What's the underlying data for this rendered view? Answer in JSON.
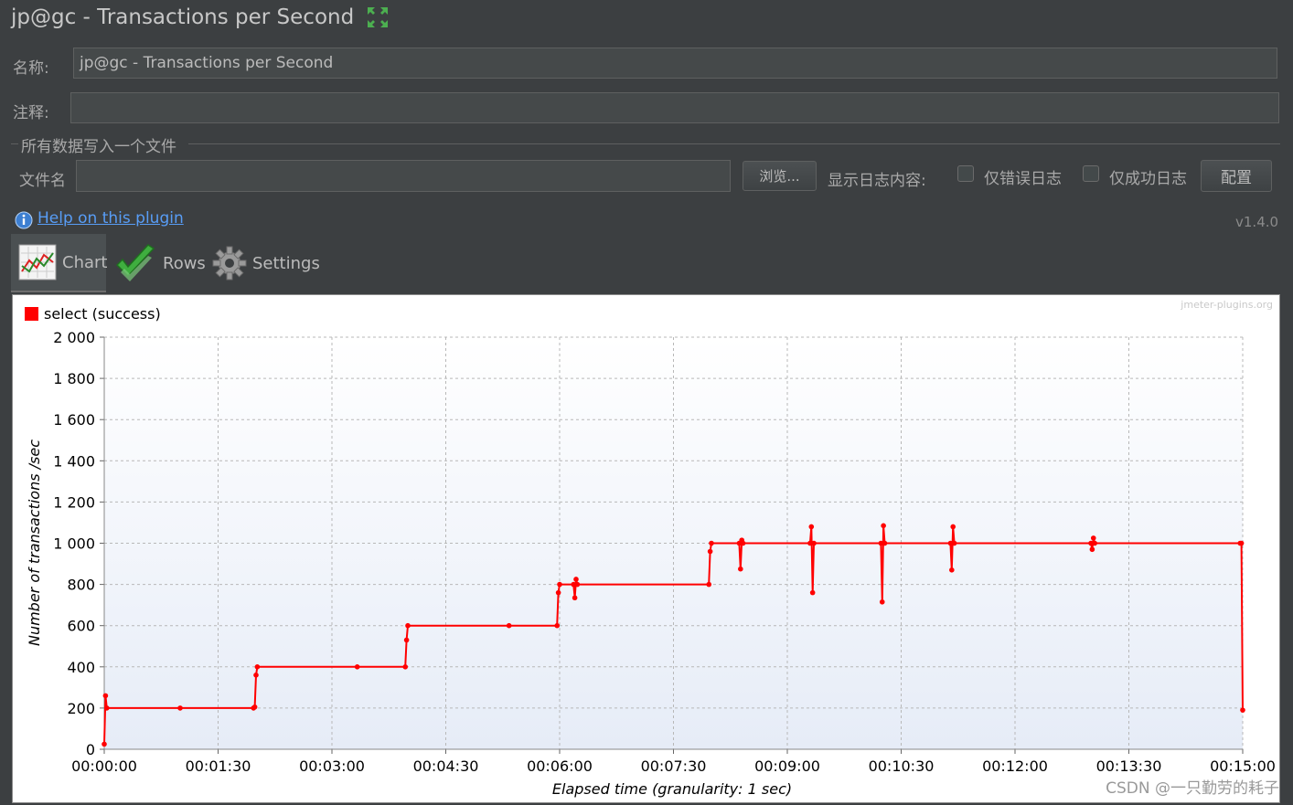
{
  "window": {
    "title": "jp@gc - Transactions per Second",
    "expand_icon": "expand-arrows-icon"
  },
  "form": {
    "name_label": "名称:",
    "name_value": "jp@gc - Transactions per Second",
    "comment_label": "注释:",
    "comment_value": "",
    "group_title": "所有数据写入一个文件",
    "filename_label": "文件名",
    "filename_value": "",
    "browse_button": "浏览...",
    "log_content_label": "显示日志内容:",
    "errors_only_label": "仅错误日志",
    "success_only_label": "仅成功日志",
    "configure_button": "配置"
  },
  "help": {
    "icon": "info-icon",
    "link_text": "Help on this plugin",
    "version": "v1.4.0"
  },
  "tabs": [
    {
      "label": "Chart",
      "icon": "chart-icon",
      "active": true
    },
    {
      "label": "Rows",
      "icon": "checkmark-icon",
      "active": false
    },
    {
      "label": "Settings",
      "icon": "gear-icon",
      "active": false
    }
  ],
  "watermark": "jmeter-plugins.org",
  "credit": "CSDN @一只勤劳的耗子",
  "chart_data": {
    "type": "line",
    "title": "",
    "xlabel": "Elapsed time (granularity: 1 sec)",
    "ylabel": "Number of transactions /sec",
    "ylim": [
      0,
      2000
    ],
    "xlim_seconds": [
      0,
      900
    ],
    "x_ticks": [
      "00:00:00",
      "00:01:30",
      "00:03:00",
      "00:04:30",
      "00:06:00",
      "00:07:30",
      "00:09:00",
      "00:10:30",
      "00:12:00",
      "00:13:30",
      "00:15:00"
    ],
    "y_ticks": [
      "0",
      "200",
      "400",
      "600",
      "800",
      "1 000",
      "1 200",
      "1 400",
      "1 600",
      "1 800",
      "2 000"
    ],
    "grid": true,
    "legend_position": "top-left",
    "series": [
      {
        "name": "select (success)",
        "color": "#ff0000",
        "points": [
          [
            0,
            25
          ],
          [
            1,
            260
          ],
          [
            2,
            200
          ],
          [
            60,
            200
          ],
          [
            118,
            200
          ],
          [
            119,
            205
          ],
          [
            120,
            360
          ],
          [
            121,
            400
          ],
          [
            200,
            400
          ],
          [
            238,
            400
          ],
          [
            239,
            530
          ],
          [
            240,
            600
          ],
          [
            320,
            600
          ],
          [
            358,
            600
          ],
          [
            359,
            760
          ],
          [
            360,
            800
          ],
          [
            371,
            800
          ],
          [
            372,
            735
          ],
          [
            373,
            825
          ],
          [
            374,
            800
          ],
          [
            478,
            800
          ],
          [
            479,
            960
          ],
          [
            480,
            1000
          ],
          [
            502,
            1000
          ],
          [
            503,
            875
          ],
          [
            504,
            1015
          ],
          [
            505,
            1000
          ],
          [
            558,
            1000
          ],
          [
            559,
            1080
          ],
          [
            560,
            760
          ],
          [
            561,
            1000
          ],
          [
            614,
            1000
          ],
          [
            615,
            715
          ],
          [
            616,
            1085
          ],
          [
            617,
            1000
          ],
          [
            669,
            1000
          ],
          [
            670,
            870
          ],
          [
            671,
            1080
          ],
          [
            672,
            1000
          ],
          [
            780,
            1000
          ],
          [
            781,
            970
          ],
          [
            782,
            1025
          ],
          [
            783,
            1000
          ],
          [
            898,
            1000
          ],
          [
            899,
            1000
          ],
          [
            900,
            190
          ]
        ]
      }
    ]
  }
}
